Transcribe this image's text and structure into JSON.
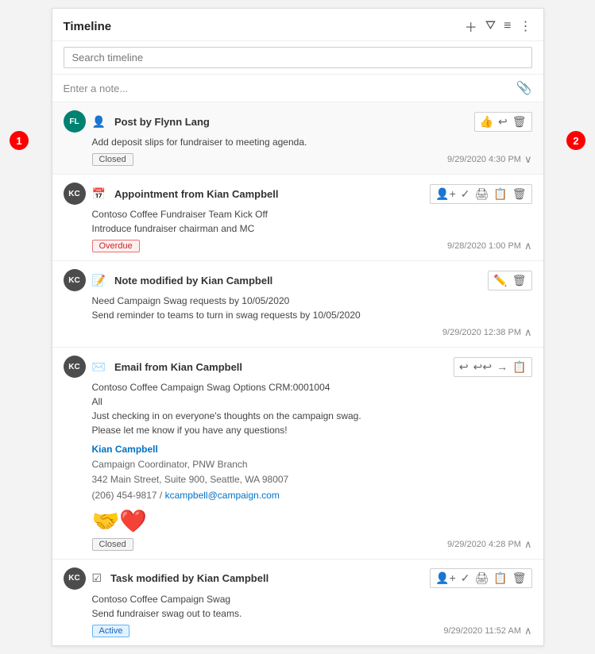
{
  "header": {
    "title": "Timeline",
    "icons": [
      "plus",
      "filter",
      "sort",
      "more"
    ]
  },
  "search": {
    "placeholder": "Search timeline"
  },
  "note_bar": {
    "placeholder": "Enter a note...",
    "attach_icon": "📎"
  },
  "items": [
    {
      "id": "post-1",
      "avatar_text": "FL",
      "avatar_class": "avatar-fl",
      "type_icon": "👤",
      "type_label": "Post",
      "title": "Post by Flynn Lang",
      "body": "Add deposit slips for fundraiser to meeting agenda.",
      "badge": "Closed",
      "badge_type": "closed",
      "timestamp": "9/29/2020 4:30 PM",
      "actions": [
        "thumbsup",
        "undo",
        "delete"
      ],
      "expanded": true
    },
    {
      "id": "appt-1",
      "avatar_text": "KC",
      "avatar_class": "avatar-kc-dark",
      "type_icon": "📅",
      "type_label": "Appointment",
      "title": "Appointment from Kian Campbell",
      "body": "Contoso Coffee Fundraiser Team Kick Off\nIntroduce fundraiser chairman and MC",
      "badge": "Overdue",
      "badge_type": "overdue",
      "timestamp": "9/28/2020 1:00 PM",
      "actions": [
        "assign",
        "complete",
        "print",
        "edit",
        "delete"
      ],
      "expanded": false
    },
    {
      "id": "note-1",
      "avatar_text": "KC",
      "avatar_class": "avatar-kc-dark",
      "type_icon": "📝",
      "type_label": "Note",
      "title": "Note modified by Kian Campbell",
      "body": "Need Campaign Swag requests by 10/05/2020\nSend reminder to teams to turn in swag requests by 10/05/2020",
      "badge": null,
      "badge_type": null,
      "timestamp": "9/29/2020 12:38 PM",
      "actions": [
        "edit",
        "delete"
      ],
      "expanded": false
    },
    {
      "id": "email-1",
      "avatar_text": "KC",
      "avatar_class": "avatar-kc-dark",
      "type_icon": "✉️",
      "type_label": "Email",
      "title": "Email from Kian Campbell",
      "body": "Contoso Coffee Campaign Swag Options CRM:0001004\nAll\nJust checking in on everyone's thoughts on the campaign swag.\nPlease let me know if you have any questions!",
      "signature_name": "Kian Campbell",
      "signature_role": "Campaign Coordinator, PNW Branch",
      "signature_address": "342 Main Street, Suite 900, Seattle, WA 98007",
      "signature_phone": "(206) 454-9817",
      "signature_email": "kcampbell@campaign.com",
      "badge": "Closed",
      "badge_type": "closed",
      "timestamp": "9/29/2020 4:28 PM",
      "actions": [
        "reply",
        "reply-all",
        "forward",
        "create"
      ],
      "expanded": false
    },
    {
      "id": "task-1",
      "avatar_text": "KC",
      "avatar_class": "avatar-kc-dark",
      "type_icon": "✔️",
      "type_label": "Task",
      "title": "Task modified by Kian Campbell",
      "body": "Contoso Coffee Campaign Swag\nSend fundraiser swag out to teams.",
      "badge": "Active",
      "badge_type": "active",
      "timestamp": "9/29/2020 11:52 AM",
      "actions": [
        "assign",
        "complete",
        "print",
        "edit",
        "delete"
      ],
      "expanded": false
    }
  ],
  "annotations": {
    "num1_label": "1",
    "num2_label": "2"
  }
}
